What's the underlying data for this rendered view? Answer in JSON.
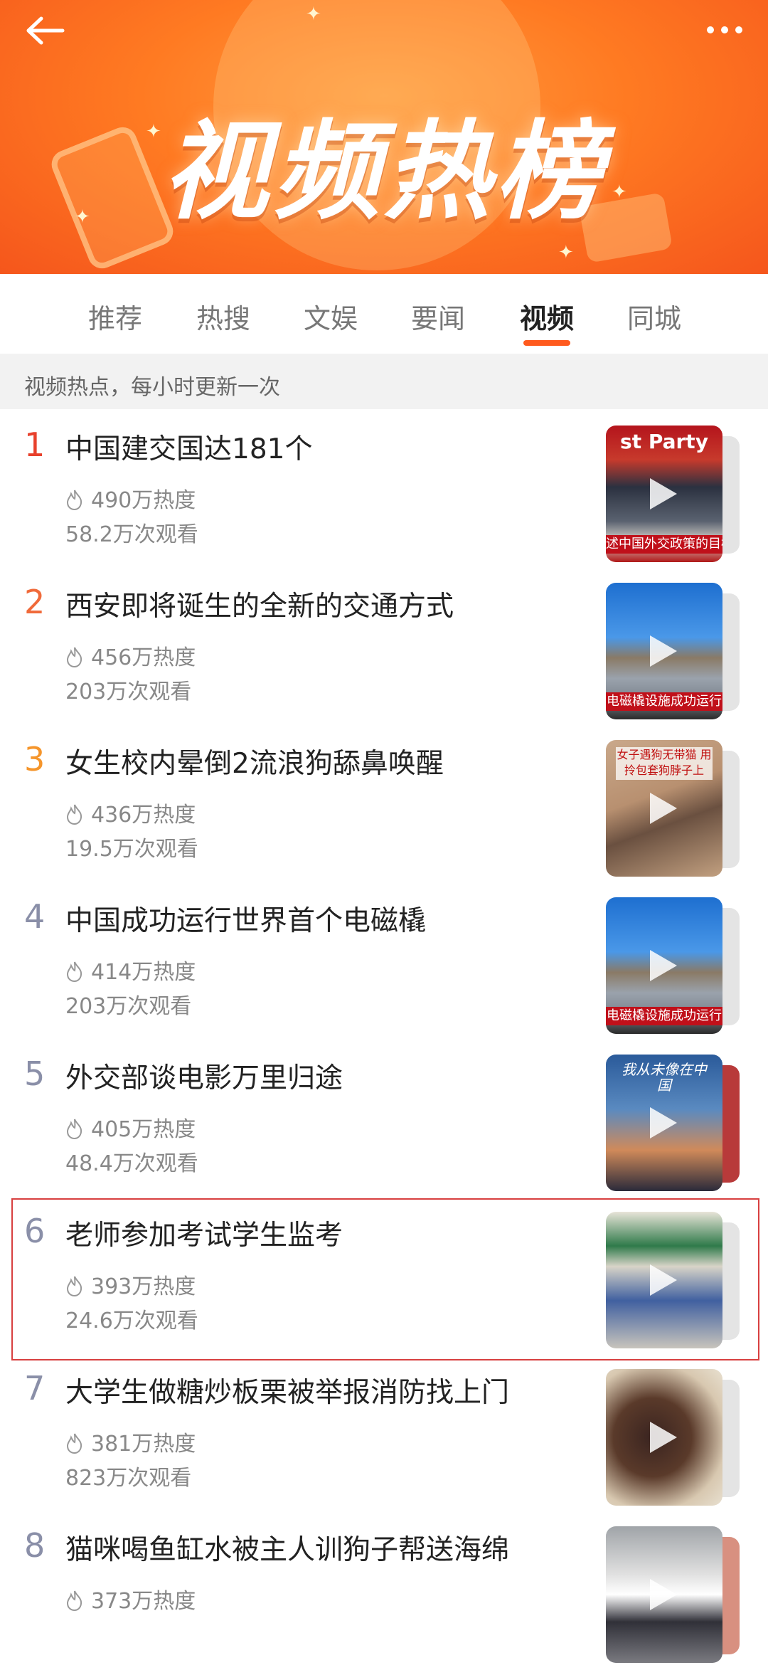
{
  "header": {
    "title": "视频热榜",
    "back_icon": "arrow-left-icon",
    "more_icon": "more-dots-icon"
  },
  "tabs": [
    {
      "label": "推荐",
      "active": false
    },
    {
      "label": "热搜",
      "active": false
    },
    {
      "label": "文娱",
      "active": false
    },
    {
      "label": "要闻",
      "active": false
    },
    {
      "label": "视频",
      "active": true
    },
    {
      "label": "同城",
      "active": false
    }
  ],
  "subheader": "视频热点，每小时更新一次",
  "colors": {
    "accent": "#ff5a1e",
    "rank_top1": "#e8412c",
    "rank_top2": "#f06a3a",
    "rank_top3": "#f5952b",
    "rank_other": "#8a8fa8",
    "highlight_border": "#d84040"
  },
  "items": [
    {
      "rank": "1",
      "title": "中国建交国达181个",
      "heat": "490万热度",
      "views": "58.2万次观看",
      "thumb_caption": "述中国外交政策的目标和方",
      "thumb_top": "st Party"
    },
    {
      "rank": "2",
      "title": "西安即将诞生的全新的交通方式",
      "heat": "456万热度",
      "views": "203万次观看",
      "thumb_caption": "电磁橇设施成功运行",
      "thumb_top": ""
    },
    {
      "rank": "3",
      "title": "女生校内晕倒2流浪狗舔鼻唤醒",
      "heat": "436万热度",
      "views": "19.5万次观看",
      "thumb_caption": "",
      "thumb_top": "女子遇狗无带猫 用拎包套狗脖子上"
    },
    {
      "rank": "4",
      "title": "中国成功运行世界首个电磁橇",
      "heat": "414万热度",
      "views": "203万次观看",
      "thumb_caption": "电磁橇设施成功运行",
      "thumb_top": ""
    },
    {
      "rank": "5",
      "title": "外交部谈电影万里归途",
      "heat": "405万热度",
      "views": "48.4万次观看",
      "thumb_caption": "",
      "thumb_top": "我从未像在中国"
    },
    {
      "rank": "6",
      "title": "老师参加考试学生监考",
      "heat": "393万热度",
      "views": "24.6万次观看",
      "thumb_caption": "",
      "thumb_top": ""
    },
    {
      "rank": "7",
      "title": "大学生做糖炒板栗被举报消防找上门",
      "heat": "381万热度",
      "views": "823万次观看",
      "thumb_caption": "",
      "thumb_top": ""
    },
    {
      "rank": "8",
      "title": "猫咪喝鱼缸水被主人训狗子帮送海绵",
      "heat": "373万热度",
      "views": "",
      "thumb_caption": "",
      "thumb_top": ""
    }
  ]
}
